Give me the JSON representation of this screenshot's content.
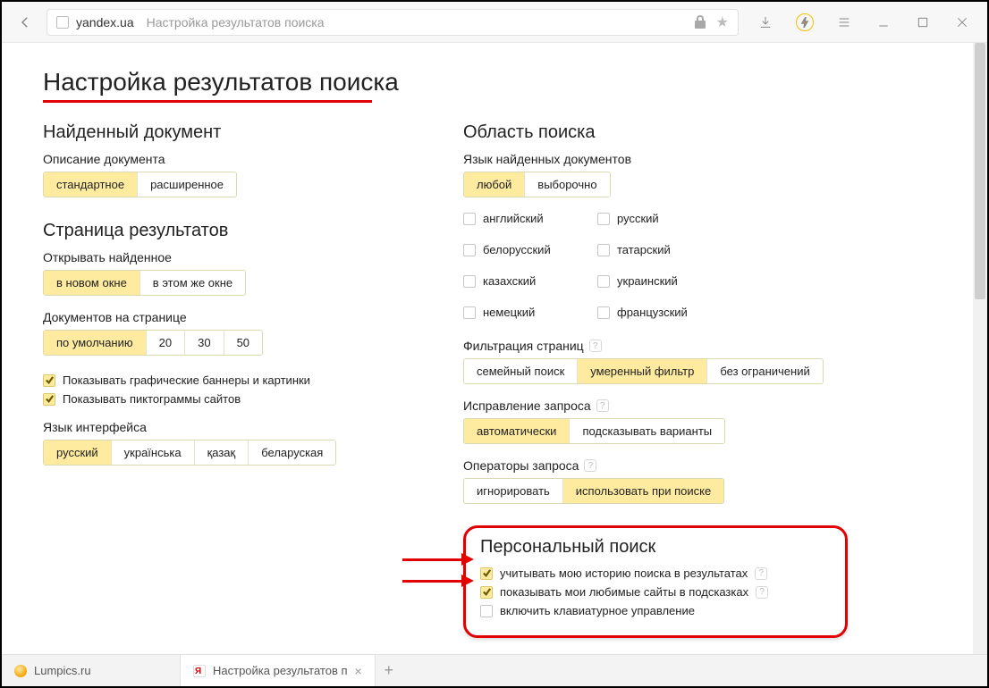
{
  "chrome": {
    "domain": "yandex.ua",
    "title": "Настройка результатов поиска"
  },
  "tabs": {
    "t0": "Lumpics.ru",
    "t1": "Настройка результатов п"
  },
  "h1": "Настройка результатов поиска",
  "left": {
    "sec1": "Найденный документ",
    "desc_label": "Описание документа",
    "desc": {
      "standard": "стандартное",
      "ext": "расширенное"
    },
    "sec2": "Страница результатов",
    "open_label": "Открывать найденное",
    "open": {
      "newwin": "в новом окне",
      "samewin": "в этом же окне"
    },
    "docs_label": "Документов на странице",
    "docs": {
      "def": "по умолчанию",
      "d20": "20",
      "d30": "30",
      "d50": "50"
    },
    "cb1": "Показывать графические баннеры и картинки",
    "cb2": "Показывать пиктограммы сайтов",
    "iface_label": "Язык интерфейса",
    "iface": {
      "ru": "русский",
      "ua": "українська",
      "kk": "қазақ",
      "by": "беларуская"
    }
  },
  "right": {
    "sec1": "Область поиска",
    "lang_label": "Язык найденных документов",
    "lang_opts": {
      "any": "любой",
      "sel": "выборочно"
    },
    "langs": {
      "l0": "английский",
      "l1": "русский",
      "l2": "белорусский",
      "l3": "татарский",
      "l4": "казахский",
      "l5": "украинский",
      "l6": "немецкий",
      "l7": "французский"
    },
    "filter_label": "Фильтрация страниц",
    "filter": {
      "family": "семейный поиск",
      "moderate": "умеренный фильтр",
      "none": "без ограничений"
    },
    "fix_label": "Исправление запроса",
    "fix": {
      "auto": "автоматически",
      "suggest": "подсказывать варианты"
    },
    "ops_label": "Операторы запроса",
    "ops": {
      "ignore": "игнорировать",
      "use": "использовать при поиске"
    },
    "personal_title": "Персональный поиск",
    "p1": "учитывать мою историю поиска в результатах",
    "p2": "показывать мои любимые сайты в подсказках",
    "p3": "включить клавиатурное управление"
  }
}
